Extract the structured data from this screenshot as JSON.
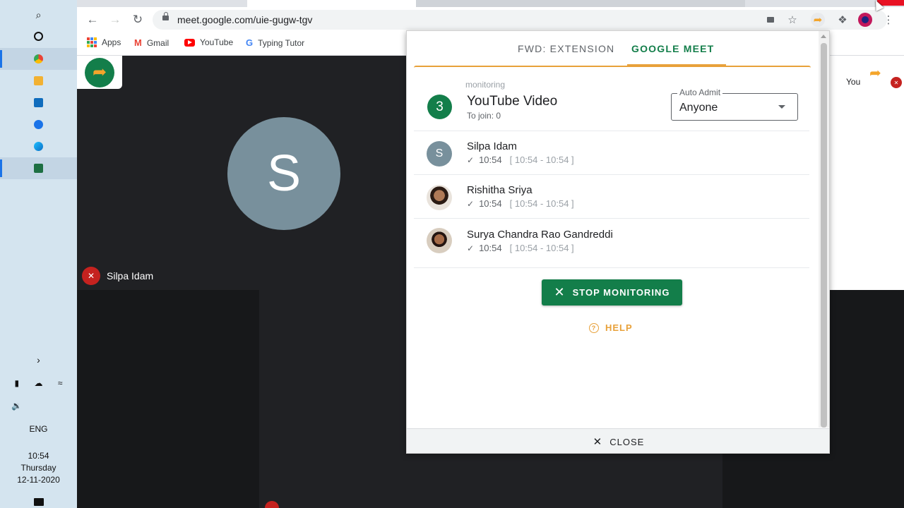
{
  "taskbar": {
    "clock_time": "10:54",
    "clock_day": "Thursday",
    "clock_date": "12-11-2020",
    "language": "ENG"
  },
  "browser": {
    "url": "meet.google.com/uie-gugw-tgv",
    "bookmarks": [
      {
        "label": "Apps"
      },
      {
        "label": "Gmail"
      },
      {
        "label": "YouTube"
      },
      {
        "label": "Typing Tutor"
      }
    ]
  },
  "meet": {
    "main_tile_initial": "S",
    "main_tile_name": "Silpa Idam",
    "self_label": "You"
  },
  "extension": {
    "tabs": [
      {
        "label": "FWD: EXTENSION"
      },
      {
        "label": "GOOGLE MEET"
      }
    ],
    "monitor": {
      "count": "3",
      "label": "monitoring",
      "title": "YouTube Video",
      "to_join": "To join: 0",
      "auto_admit_label": "Auto Admit",
      "auto_admit_value": "Anyone"
    },
    "participants": [
      {
        "initial": "S",
        "name": "Silpa Idam",
        "time": "10:54",
        "range": "[ 10:54 - 10:54 ]"
      },
      {
        "initial": "",
        "name": "Rishitha Sriya",
        "time": "10:54",
        "range": "[ 10:54 - 10:54 ]"
      },
      {
        "initial": "",
        "name": "Surya Chandra Rao Gandreddi",
        "time": "10:54",
        "range": "[ 10:54 - 10:54 ]"
      }
    ],
    "stop_label": "STOP MONITORING",
    "help_label": "HELP",
    "close_label": "CLOSE"
  },
  "colors": {
    "brand_green": "#137e4a",
    "accent_orange": "#e8a13a"
  }
}
